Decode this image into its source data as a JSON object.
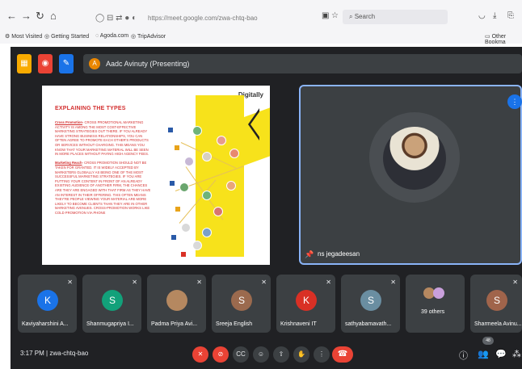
{
  "browser": {
    "url": "https://meet.google.com/zwa-chtq-bao",
    "search_placeholder": "Search",
    "bookmarks": [
      "Most Visited",
      "Getting Started",
      "Agoda.com",
      "TripAdvisor",
      "Other Bookma"
    ]
  },
  "meet": {
    "presenting_label": "Aadc Avinuty (Presenting)",
    "presenting_initial": "A",
    "slide": {
      "logo": "Digitally",
      "title": "EXPLAINING THE TYPES",
      "para1_term": "Cross Promotion",
      "para1": "- CROSS PROMOTIONAL MARKETING ACTIVITY IS AMONG THE MOST COST-EFFECTIVE MARKETING STRATEGIES OUT THERE. IF YOU ALREADY HAVE STRONG BUSINESS RELATIONSHIPS, YOU CAN OFTEN AGREE TO PROMOTE EACH OTHER'S PRODUCTS OR SERVICES WITHOUT CHARGING. THIS MEANS YOU KNOW THAT YOUR MARKETING MATERIAL WILL BE SEEN IN MORE PLACES WITHOUT PAYING HIGH AGENCY FEES.",
      "para2_term": "Marketing Reach",
      "para2": "- CROSS PROMOTION SHOULD NOT BE TAKEN FOR GRANTED. IT IS WIDELY ACCEPTED BY MARKETERS GLOBALLY AS BEING ONE OF THE MOST SUCCESSFUL MARKETING STRATEGIES. IF YOU ARE PUTTING YOUR CONTENT IN FRONT OF AN ALREADY EXISTING AUDIENCE OF ANOTHER FIRM, THE CHANCES ARE THEY ARE ENGAGED WITH THAT FIRM AS THEY HAVE AN INTEREST IN THEIR OFFERING. THIS OFTEN MEANS THEY'RE PEOPLE VIEWING YOUR MATERIAL ARE MORE LIKELY TO BECOME CLIENTS THAN THEY ARE IN OTHER MARKETING AVENUES. CROSS-PROMOTION WORKS LIKE COLD PROMOTION VIA PHONE"
    },
    "main_participant": "ns jegadeesan",
    "participants": [
      {
        "name": "Kaviyaharshini A...",
        "initial": "K",
        "color": "#1a73e8"
      },
      {
        "name": "Shanmugapriya I...",
        "initial": "S",
        "color": "#12a17a"
      },
      {
        "name": "Padma Priya Avi...",
        "initial": "",
        "color": "#b58860"
      },
      {
        "name": "Sreeja English",
        "initial": "S",
        "color": "#9b6a4e"
      },
      {
        "name": "Krishnaveni IT",
        "initial": "K",
        "color": "#d93025"
      },
      {
        "name": "sathyabamavath...",
        "initial": "S",
        "color": "#6a8ea1"
      },
      {
        "name": "39 others",
        "initial": "",
        "color": "#3c4043"
      },
      {
        "name": "Sharmeela Avinu...",
        "initial": "S",
        "color": "#a0644b"
      }
    ],
    "time": "3:17 PM",
    "separator": "|",
    "meeting_code": "zwa-chtq-bao",
    "participant_count": "48"
  }
}
